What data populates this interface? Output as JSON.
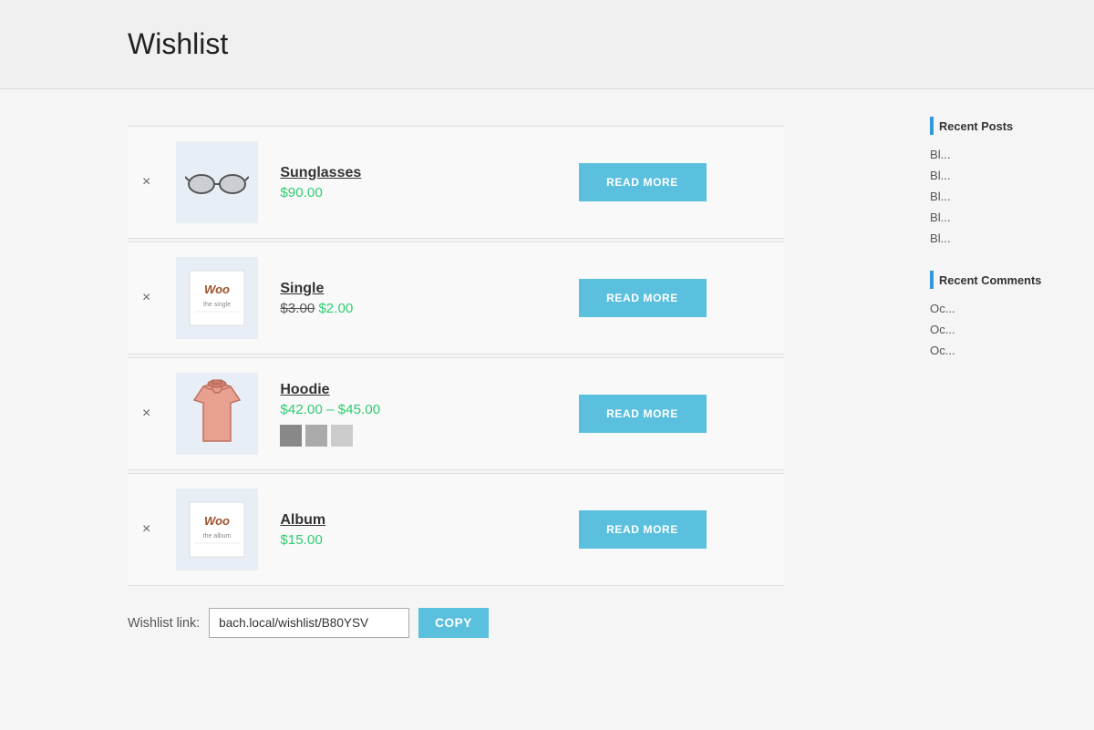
{
  "page": {
    "title": "Wishlist"
  },
  "wishlist": {
    "items": [
      {
        "id": "sunglasses",
        "name": "Sunglasses",
        "price_display": "$90.00",
        "price_type": "single",
        "image_type": "sunglasses"
      },
      {
        "id": "single",
        "name": "Single",
        "price_display": "$3.00",
        "price_sale": "$2.00",
        "price_type": "sale",
        "image_type": "woo-single"
      },
      {
        "id": "hoodie",
        "name": "Hoodie",
        "price_range": "$42.00 – $45.00",
        "price_type": "range",
        "image_type": "hoodie",
        "swatches": [
          "#888",
          "#aaa",
          "#ccc"
        ]
      },
      {
        "id": "album",
        "name": "Album",
        "price_display": "$15.00",
        "price_type": "single",
        "image_type": "woo-album"
      }
    ],
    "read_more_label": "READ MORE",
    "remove_icon": "×",
    "link_label": "Wishlist link:",
    "link_value": "bach.local/wishlist/B80YSV",
    "copy_label": "COPY"
  },
  "sidebar": {
    "recent_posts": {
      "title": "Recent Posts",
      "items": [
        "Bl",
        "Bl",
        "Bl",
        "Bl",
        "Bl"
      ]
    },
    "recent_comments": {
      "title": "Recent Comments",
      "items": [
        "Oc",
        "Oc",
        "Oc"
      ]
    }
  }
}
